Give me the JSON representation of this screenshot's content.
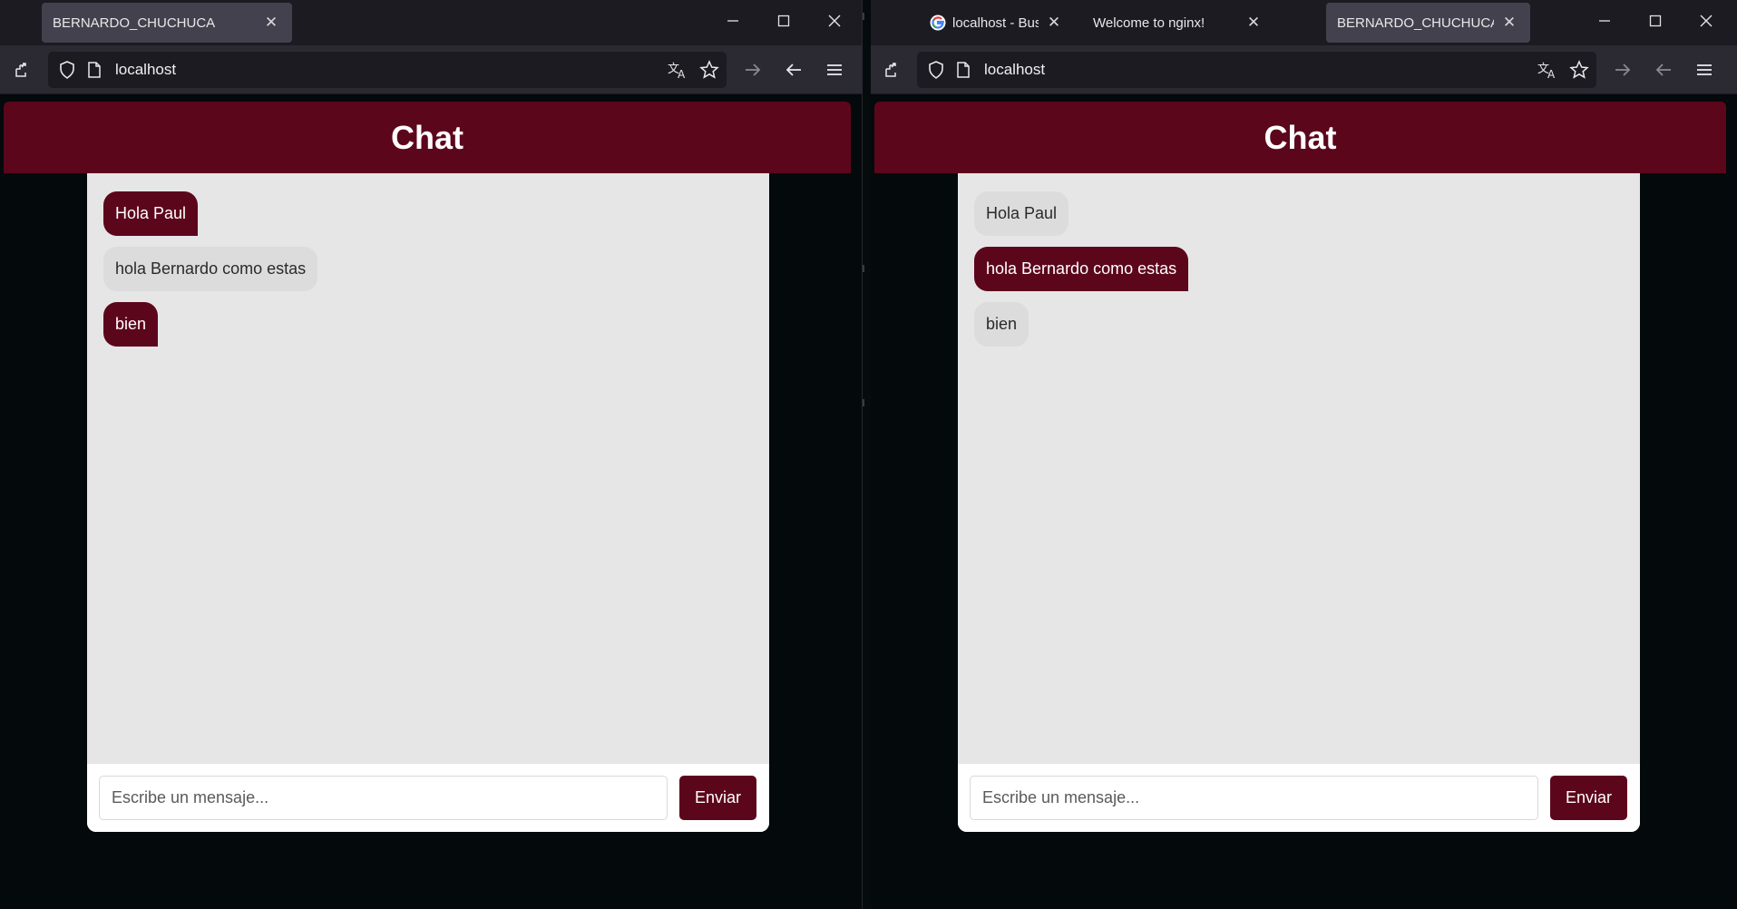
{
  "left_window": {
    "tabs": [
      {
        "label": "BERNARDO_CHUCHUCA",
        "active": true
      }
    ],
    "url": "localhost",
    "chat": {
      "title": "Chat",
      "messages": [
        {
          "text": "Hola Paul",
          "from": "mine"
        },
        {
          "text": "hola Bernardo como estas",
          "from": "theirs"
        },
        {
          "text": "bien",
          "from": "mine"
        }
      ],
      "input_placeholder": "Escribe un mensaje...",
      "send_label": "Enviar"
    }
  },
  "right_window": {
    "tabs": [
      {
        "label": "localhost - Buscar con G",
        "active": false,
        "icon": "google-icon"
      },
      {
        "label": "Welcome to nginx!",
        "active": false
      },
      {
        "label": "BERNARDO_CHUCHUCA",
        "active": true
      }
    ],
    "url": "localhost",
    "chat": {
      "title": "Chat",
      "messages": [
        {
          "text": "Hola Paul",
          "from": "theirs"
        },
        {
          "text": "hola Bernardo como estas",
          "from": "mine"
        },
        {
          "text": "bien",
          "from": "theirs"
        }
      ],
      "input_placeholder": "Escribe un mensaje...",
      "send_label": "Enviar"
    }
  },
  "colors": {
    "accent": "#5c061c",
    "page_background": "#04090c",
    "chat_background": "#e6e6e6",
    "received_bubble": "#dcdcdc",
    "browser_chrome": "#2b2a33"
  },
  "icons": [
    "minimize-icon",
    "maximize-icon",
    "close-icon",
    "extensions-icon",
    "shield-icon",
    "page-icon",
    "translate-icon",
    "star-icon",
    "forward-arrow-icon",
    "back-arrow-icon",
    "menu-icon",
    "google-icon"
  ]
}
